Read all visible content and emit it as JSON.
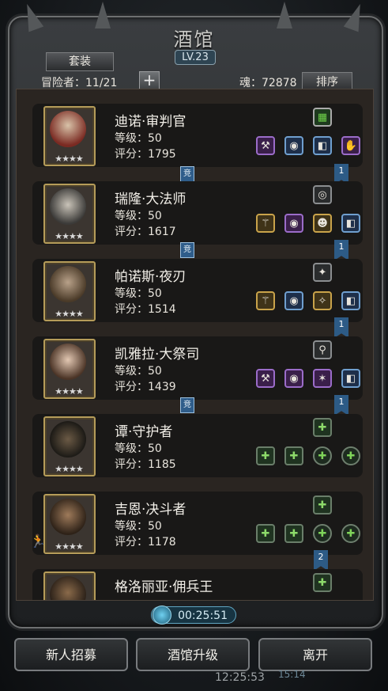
{
  "header": {
    "title": "酒馆",
    "level": "LV.23"
  },
  "toolbar": {
    "suit_label": "套装",
    "adventurers_label": "冒险者：11/21",
    "add_label": "+",
    "soul_label": "魂：72878",
    "sort_label": "排序"
  },
  "heroes": [
    {
      "name": "迪诺·审判官",
      "level": "等级：50",
      "score": "评分：1795",
      "stars": "★★★★"
    },
    {
      "name": "瑞隆·大法师",
      "level": "等级：50",
      "score": "评分：1617",
      "stars": "★★★★"
    },
    {
      "name": "帕诺斯·夜刃",
      "level": "等级：50",
      "score": "评分：1514",
      "stars": "★★★★"
    },
    {
      "name": "凯雅拉·大祭司",
      "level": "等级：50",
      "score": "评分：1439",
      "stars": "★★★★"
    },
    {
      "name": "谭·守护者",
      "level": "等级：50",
      "score": "评分：1185",
      "stars": "★★★★"
    },
    {
      "name": "吉恩·决斗者",
      "level": "等级：50",
      "score": "评分：1178",
      "stars": "★★★★"
    },
    {
      "name": "格洛丽亚·佣兵王",
      "level": "",
      "score": "",
      "stars": ""
    }
  ],
  "badges": {
    "compete": "竞",
    "flag1": "1",
    "flag2": "2"
  },
  "timer": "00:25:51",
  "footer": {
    "recruit_label": "新人招募",
    "upgrade_label": "酒馆升级",
    "leave_label": "离开"
  },
  "status": {
    "clock": "12:25:53",
    "extra": "15:14"
  },
  "colors": {
    "accent_blue": "#2d5b86",
    "portrait_border": "#b59c59",
    "purple_slot": "#9b6cc9"
  }
}
